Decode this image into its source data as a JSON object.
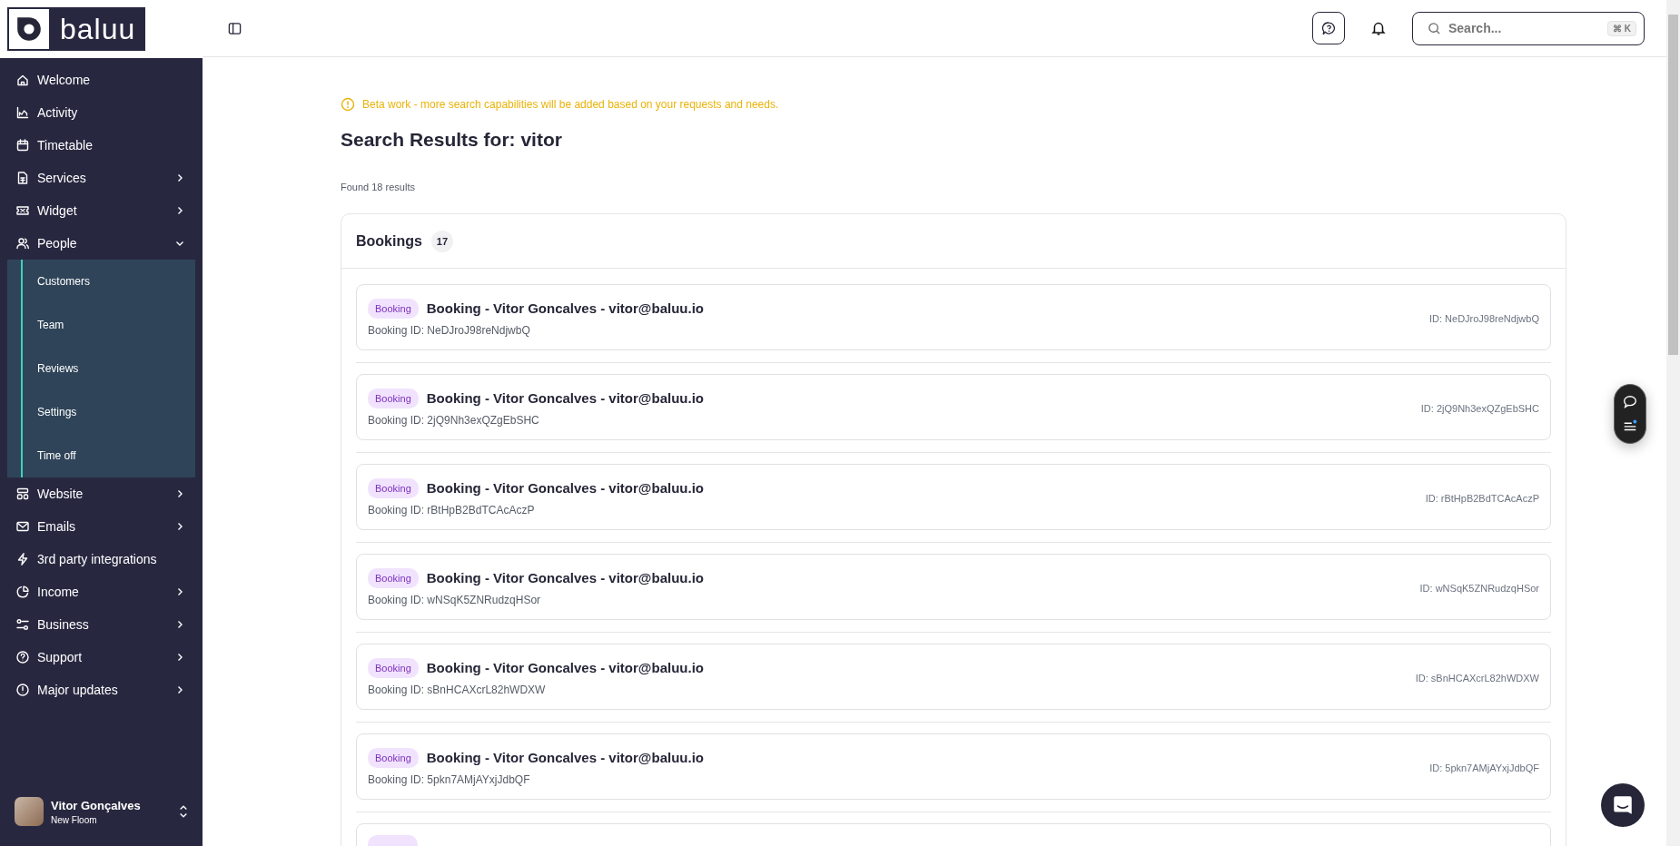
{
  "logo": {
    "text": "baluu"
  },
  "sidebar": {
    "items": [
      {
        "label": "Welcome",
        "kind": "link"
      },
      {
        "label": "Activity",
        "kind": "link"
      },
      {
        "label": "Timetable",
        "kind": "link"
      },
      {
        "label": "Services",
        "kind": "group",
        "expanded": false
      },
      {
        "label": "Widget",
        "kind": "group",
        "expanded": false
      },
      {
        "label": "People",
        "kind": "group",
        "expanded": true,
        "children": [
          {
            "label": "Customers"
          },
          {
            "label": "Team"
          },
          {
            "label": "Reviews"
          },
          {
            "label": "Settings"
          },
          {
            "label": "Time off"
          }
        ]
      },
      {
        "label": "Website",
        "kind": "group",
        "expanded": false
      },
      {
        "label": "Emails",
        "kind": "group",
        "expanded": false
      },
      {
        "label": "3rd party integrations",
        "kind": "link"
      },
      {
        "label": "Income",
        "kind": "group",
        "expanded": false
      },
      {
        "label": "Business",
        "kind": "group",
        "expanded": false
      },
      {
        "label": "Support",
        "kind": "group",
        "expanded": false
      },
      {
        "label": "Major updates",
        "kind": "group",
        "expanded": false
      }
    ]
  },
  "user": {
    "name": "Vitor Gonçalves",
    "workspace": "New Floom"
  },
  "search": {
    "placeholder": "Search...",
    "shortcut": "⌘ K"
  },
  "notice": "Beta work - more search capabilities will be added based on your requests and needs.",
  "heading": "Search Results for: vitor",
  "result_count": "Found 18 results",
  "section": {
    "title": "Bookings",
    "count": "17",
    "more_below": true,
    "results": [
      {
        "tag": "Booking",
        "title": "Booking - Vitor Goncalves - vitor@baluu.io",
        "subtitle": "Booking ID: NeDJroJ98reNdjwbQ",
        "id": "ID: NeDJroJ98reNdjwbQ"
      },
      {
        "tag": "Booking",
        "title": "Booking - Vitor Goncalves - vitor@baluu.io",
        "subtitle": "Booking ID: 2jQ9Nh3exQZgEbSHC",
        "id": "ID: 2jQ9Nh3exQZgEbSHC"
      },
      {
        "tag": "Booking",
        "title": "Booking - Vitor Goncalves - vitor@baluu.io",
        "subtitle": "Booking ID: rBtHpB2BdTCAcAczP",
        "id": "ID: rBtHpB2BdTCAcAczP"
      },
      {
        "tag": "Booking",
        "title": "Booking - Vitor Goncalves - vitor@baluu.io",
        "subtitle": "Booking ID: wNSqK5ZNRudzqHSor",
        "id": "ID: wNSqK5ZNRudzqHSor"
      },
      {
        "tag": "Booking",
        "title": "Booking - Vitor Goncalves - vitor@baluu.io",
        "subtitle": "Booking ID: sBnHCAXcrL82hWDXW",
        "id": "ID: sBnHCAXcrL82hWDXW"
      },
      {
        "tag": "Booking",
        "title": "Booking - Vitor Goncalves - vitor@baluu.io",
        "subtitle": "Booking ID: 5pkn7AMjAYxjJdbQF",
        "id": "ID: 5pkn7AMjAYxjJdbQF"
      }
    ]
  }
}
